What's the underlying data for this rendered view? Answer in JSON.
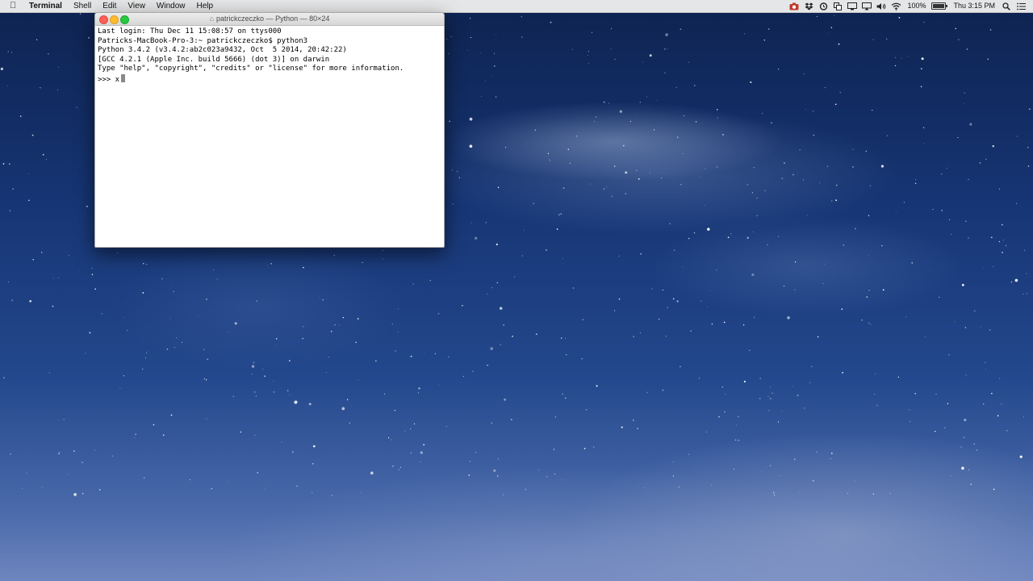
{
  "menubar": {
    "app_name": "Terminal",
    "menus": [
      "Shell",
      "Edit",
      "View",
      "Window",
      "Help"
    ],
    "battery": "100%",
    "clock": "Thu 3:15 PM",
    "status_icons": [
      "camera-icon",
      "dropbox-icon",
      "sync-icon",
      "copy-icon",
      "display-icon",
      "airplay-icon",
      "volume-icon",
      "wifi-icon"
    ]
  },
  "terminal": {
    "title": "patrickczeczko — Python — 80×24",
    "lines": [
      "Last login: Thu Dec 11 15:08:57 on ttys000",
      "Patricks-MacBook-Pro-3:~ patrickczeczko$ python3",
      "Python 3.4.2 (v3.4.2:ab2c023a9432, Oct  5 2014, 20:42:22)",
      "[GCC 4.2.1 (Apple Inc. build 5666) (dot 3)] on darwin",
      "Type \"help\", \"copyright\", \"credits\" or \"license\" for more information."
    ],
    "prompt_line": ">>> x"
  },
  "colors": {
    "close": "#fc5f57",
    "minimize": "#fdbb2e",
    "zoom": "#28c840"
  },
  "battery_level": 1.0
}
